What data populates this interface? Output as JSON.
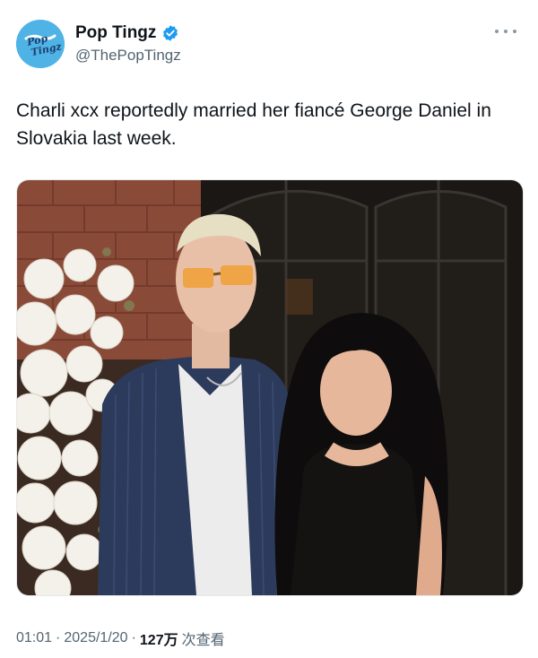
{
  "author": {
    "display_name": "Pop Tingz",
    "handle": "@ThePopTingz",
    "avatar_logo_text": "Pop Tingz",
    "verified": true,
    "verified_color": "#1d9bf0",
    "avatar_color": "#4fb3e6"
  },
  "tweet": {
    "text": "Charli xcx reportedly married her fiancé George Daniel in Slovakia last week.",
    "media_icon": "photo"
  },
  "meta": {
    "time": "01:01",
    "separator": "·",
    "date": "2025/1/20",
    "views_count": "127万",
    "views_label": "次查看"
  },
  "icons": {
    "more": "more-horizontal-icon",
    "verified": "verified-badge-icon"
  }
}
